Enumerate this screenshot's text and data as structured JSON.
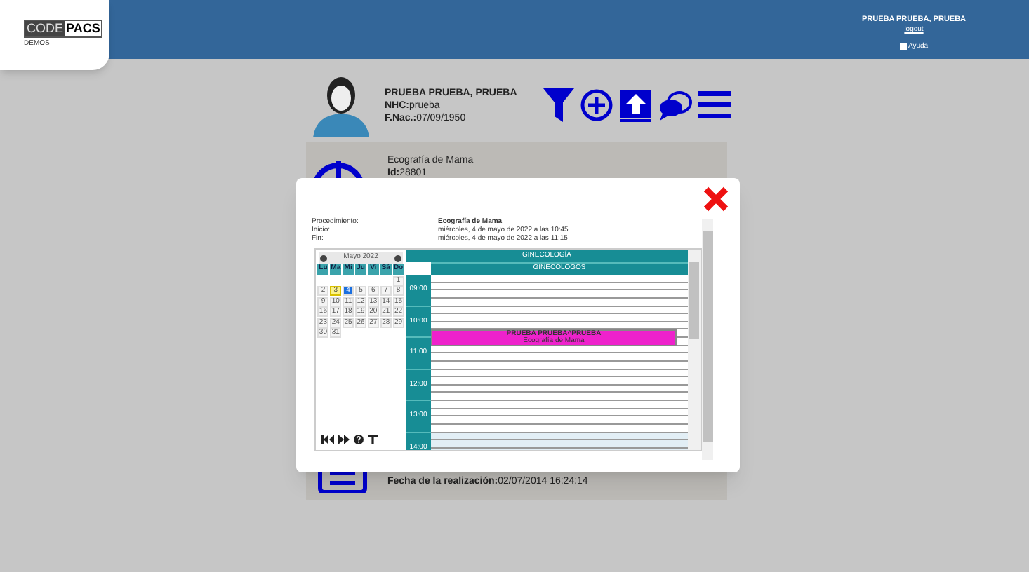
{
  "logo": {
    "part_1": "CODE",
    "part_2": "PACS",
    "subtitle": "DEMOS"
  },
  "header": {
    "user": "PRUEBA PRUEBA, PRUEBA",
    "logout": "logout",
    "help": "Ayuda"
  },
  "patient": {
    "name": "PRUEBA PRUEBA, PRUEBA",
    "nhc_label": "NHC:",
    "nhc": "prueba",
    "birth_label": "F.Nac.:",
    "birth": "07/09/1950"
  },
  "study": {
    "title": "Ecografía de Mama",
    "id_label": "Id:",
    "id": "28801",
    "done_label": "Fecha de la realización:",
    "done": "02/07/2014 16:24:14"
  },
  "dialog": {
    "info": [
      {
        "label": "Procedimiento:",
        "value": "Ecografía de Mama",
        "bold": true
      },
      {
        "label": "Inicio:",
        "value": "miércoles, 4 de mayo de 2022 a las 10:45",
        "bold": false
      },
      {
        "label": "Fin:",
        "value": "miércoles, 4 de mayo de 2022 a las 11:15",
        "bold": false
      }
    ],
    "calendar": {
      "month": "Mayo 2022",
      "weekdays": [
        "Lu",
        "Ma",
        "Mi",
        "Ju",
        "Vi",
        "Sá",
        "Do"
      ],
      "weeks": [
        [
          {
            "kind": "blank"
          },
          {
            "kind": "blank"
          },
          {
            "kind": "blank"
          },
          {
            "kind": "blank"
          },
          {
            "kind": "blank"
          },
          {
            "kind": "blank"
          },
          {
            "day": "1",
            "today": false,
            "selected": false
          }
        ],
        [
          {
            "day": "2",
            "today": false,
            "selected": false
          },
          {
            "day": "3",
            "today": true,
            "selected": false
          },
          {
            "day": "4",
            "today": false,
            "selected": true
          },
          {
            "day": "5",
            "today": false,
            "selected": false
          },
          {
            "day": "6",
            "today": false,
            "selected": false
          },
          {
            "day": "7",
            "today": false,
            "selected": false
          },
          {
            "day": "8",
            "today": false,
            "selected": false
          }
        ],
        [
          {
            "day": "9",
            "today": false,
            "selected": false
          },
          {
            "day": "10",
            "today": false,
            "selected": false
          },
          {
            "day": "11",
            "today": false,
            "selected": false
          },
          {
            "day": "12",
            "today": false,
            "selected": false
          },
          {
            "day": "13",
            "today": false,
            "selected": false
          },
          {
            "day": "14",
            "today": false,
            "selected": false
          },
          {
            "day": "15",
            "today": false,
            "selected": false
          }
        ],
        [
          {
            "day": "16",
            "today": false,
            "selected": false
          },
          {
            "day": "17",
            "today": false,
            "selected": false
          },
          {
            "day": "18",
            "today": false,
            "selected": false
          },
          {
            "day": "19",
            "today": false,
            "selected": false
          },
          {
            "day": "20",
            "today": false,
            "selected": false
          },
          {
            "day": "21",
            "today": false,
            "selected": false
          },
          {
            "day": "22",
            "today": false,
            "selected": false
          }
        ],
        [
          {
            "day": "23",
            "today": false,
            "selected": false
          },
          {
            "day": "24",
            "today": false,
            "selected": false
          },
          {
            "day": "25",
            "today": false,
            "selected": false
          },
          {
            "day": "26",
            "today": false,
            "selected": false
          },
          {
            "day": "27",
            "today": false,
            "selected": false
          },
          {
            "day": "28",
            "today": false,
            "selected": false
          },
          {
            "day": "29",
            "today": false,
            "selected": false
          }
        ],
        [
          {
            "day": "30",
            "today": false,
            "selected": false
          },
          {
            "day": "31",
            "today": false,
            "selected": false
          },
          {
            "kind": "blank"
          },
          {
            "kind": "blank"
          },
          {
            "kind": "blank"
          },
          {
            "kind": "blank"
          },
          {
            "kind": "blank"
          }
        ]
      ]
    },
    "schedule": {
      "service": "GINECOLOGÍA",
      "resource": "GINECOLOGOS",
      "hours": [
        "09:00",
        "10:00",
        "11:00",
        "12:00",
        "13:00",
        "14:00"
      ],
      "event": {
        "patient": "PRUEBA PRUEBA^PRUEBA",
        "procedure": "Ecografía de Mama",
        "color": "#ee22cc"
      }
    }
  }
}
